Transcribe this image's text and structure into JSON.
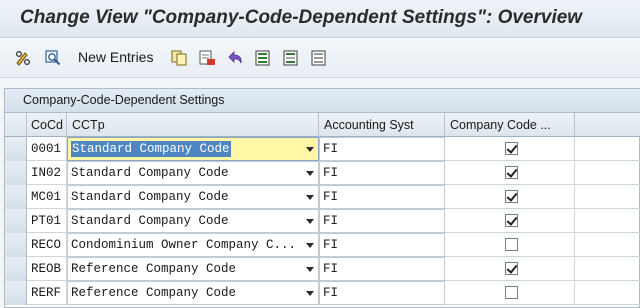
{
  "window": {
    "title": "Change View \"Company-Code-Dependent Settings\": Overview"
  },
  "toolbar": {
    "icons": [
      "pencil-glasses-icon",
      "display-icon",
      "copy-icon",
      "delete-icon",
      "undo-icon",
      "select-all-icon",
      "select-block-icon",
      "deselect-all-icon"
    ],
    "new_entries_label": "New Entries"
  },
  "panel": {
    "title": "Company-Code-Dependent Settings"
  },
  "table": {
    "columns": {
      "cocd": "CoCd",
      "cctp": "CCTp",
      "accounting": "Accounting Syst",
      "company_code": "Company Code ..."
    },
    "rows": [
      {
        "cocd": "0001",
        "cctp": "Standard Company Code",
        "accounting": "FI",
        "checked": true,
        "focused": true
      },
      {
        "cocd": "IN02",
        "cctp": "Standard Company Code",
        "accounting": "FI",
        "checked": true,
        "focused": false
      },
      {
        "cocd": "MC01",
        "cctp": "Standard Company Code",
        "accounting": "FI",
        "checked": true,
        "focused": false
      },
      {
        "cocd": "PT01",
        "cctp": "Standard Company Code",
        "accounting": "FI",
        "checked": true,
        "focused": false
      },
      {
        "cocd": "RECO",
        "cctp": "Condominium Owner Company C...",
        "accounting": "FI",
        "checked": false,
        "focused": false
      },
      {
        "cocd": "REOB",
        "cctp": "Reference Company Code",
        "accounting": "FI",
        "checked": true,
        "focused": false
      },
      {
        "cocd": "RERF",
        "cctp": "Reference Company Code",
        "accounting": "FI",
        "checked": false,
        "focused": false
      }
    ]
  },
  "colors": {
    "focus_field": "#fff6a6",
    "selection_highlight": "#4e86c2"
  }
}
